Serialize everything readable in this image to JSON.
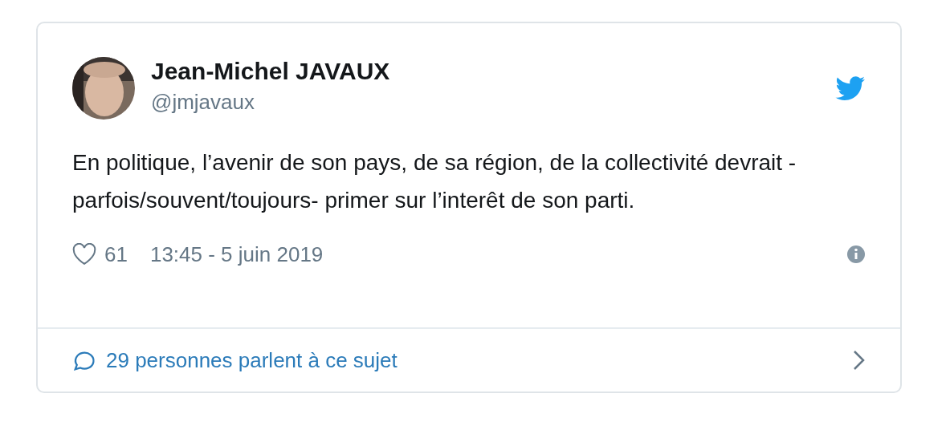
{
  "tweet": {
    "author": {
      "name": "Jean-Michel JAVAUX",
      "handle": "@jmjavaux"
    },
    "text": "En politique, l’avenir de son pays, de sa région, de la collectivité devrait -parfois/souvent/toujours- primer sur l’interêt de son parti.",
    "likes": "61",
    "timestamp": "13:45 - 5 juin 2019",
    "conversation": "29 personnes parlent à ce sujet"
  }
}
